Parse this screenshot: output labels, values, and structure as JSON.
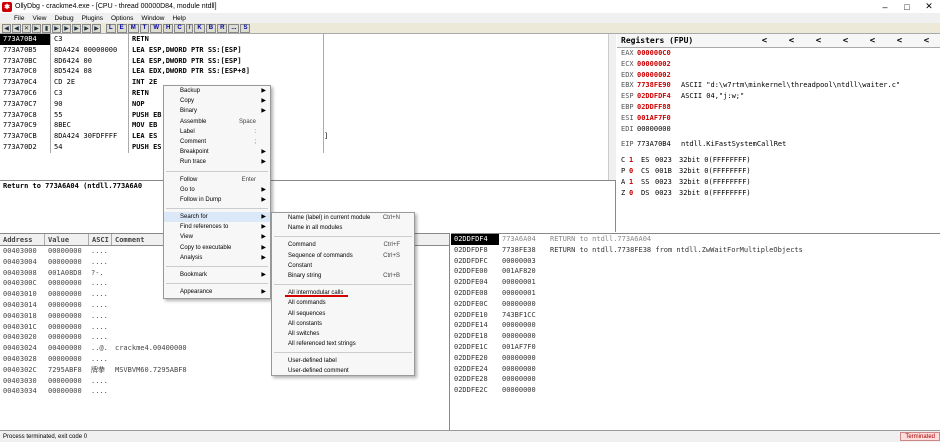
{
  "titlebar": {
    "title": "OllyDbg - crackme4.exe - [CPU - thread 00000D84, module ntdll]",
    "icon": "ollydbg-icon",
    "min": "–",
    "max": "□",
    "close": "✕"
  },
  "menubar": [
    "File",
    "View",
    "Debug",
    "Plugins",
    "Options",
    "Window",
    "Help"
  ],
  "toolbar": {
    "buttons": [
      "◀",
      "◀",
      "✕",
      "▶",
      "▮",
      "▶",
      "▶",
      "▶",
      "▶",
      "▶"
    ],
    "letters": [
      "L",
      "E",
      "M",
      "T",
      "W",
      "H",
      "C",
      "/",
      "K",
      "B",
      "R",
      "...",
      "S"
    ]
  },
  "cpu": {
    "rows": [
      {
        "addr": "773A70B4",
        "hex": "C3",
        "dis": "RETN",
        "cmt": ""
      },
      {
        "addr": "773A70B5",
        "hex": "8DA424 00000000",
        "dis": "LEA ESP,DWORD PTR SS:[ESP]",
        "cmt": ""
      },
      {
        "addr": "773A70BC",
        "hex": "8D6424 00",
        "dis": "LEA ESP,DWORD PTR SS:[ESP]",
        "cmt": ""
      },
      {
        "addr": "773A70C0",
        "hex": "8D5424 08",
        "dis": "LEA EDX,DWORD PTR SS:[ESP+8]",
        "cmt": ""
      },
      {
        "addr": "773A70C4",
        "hex": "CD 2E",
        "dis": "INT 2E",
        "cmt": ""
      },
      {
        "addr": "773A70C6",
        "hex": "C3",
        "dis": "RETN",
        "cmt": ""
      },
      {
        "addr": "773A70C7",
        "hex": "90",
        "dis": "NOP",
        "cmt": ""
      },
      {
        "addr": "773A70C8",
        "hex": "55",
        "dis": "PUSH EB",
        "cmt": ""
      },
      {
        "addr": "773A70C9",
        "hex": "8BEC",
        "dis": "MOV EB",
        "cmt": ""
      },
      {
        "addr": "773A70CB",
        "hex": "8DA424 30FDFFFF",
        "dis": "LEA ES",
        "cmt": "]"
      },
      {
        "addr": "773A70D2",
        "hex": "54",
        "dis": "PUSH ES",
        "cmt": ""
      }
    ]
  },
  "info": {
    "line1": "Return to 773A6A04 (ntdll.773A6A0"
  },
  "registers": {
    "title": "Registers (FPU)",
    "arrows": [
      "<",
      "<",
      "<",
      "<",
      "<",
      "<",
      "<"
    ],
    "rows": [
      {
        "name": "EAX",
        "val": "000000C0",
        "red": true,
        "cmt": ""
      },
      {
        "name": "ECX",
        "val": "00000002",
        "red": true,
        "cmt": ""
      },
      {
        "name": "EDX",
        "val": "00000002",
        "red": true,
        "cmt": ""
      },
      {
        "name": "EBX",
        "val": "7738FE90",
        "red": true,
        "cmt": "ASCII \"d:\\w7rtm\\minkernel\\threadpool\\ntdll\\waiter.c\""
      },
      {
        "name": "ESP",
        "val": "02DDFDF4",
        "red": true,
        "cmt": "ASCII 04,\"j:w;\""
      },
      {
        "name": "EBP",
        "val": "02DDFF88",
        "red": true,
        "cmt": ""
      },
      {
        "name": "ESI",
        "val": "001AF7F0",
        "red": true,
        "cmt": ""
      },
      {
        "name": "EDI",
        "val": "00000000",
        "red": false,
        "cmt": ""
      }
    ],
    "eip": {
      "name": "EIP",
      "val": "773A70B4",
      "cmt": "ntdll.KiFastSystemCallRet"
    },
    "flags": [
      {
        "f": "C",
        "b": "1",
        "seg": "ES",
        "sv": "0023",
        "info": "32bit 0(FFFFFFFF)"
      },
      {
        "f": "P",
        "b": "0",
        "seg": "CS",
        "sv": "001B",
        "info": "32bit 0(FFFFFFFF)"
      },
      {
        "f": "A",
        "b": "1",
        "seg": "SS",
        "sv": "0023",
        "info": "32bit 0(FFFFFFFF)"
      },
      {
        "f": "Z",
        "b": "0",
        "seg": "DS",
        "sv": "0023",
        "info": "32bit 0(FFFFFFFF)"
      }
    ]
  },
  "dump": {
    "headers": [
      "Address",
      "Value",
      "ASCI",
      "Comment"
    ],
    "rows": [
      {
        "a": "00403000",
        "v": "00000000",
        "s": "....",
        "m": ""
      },
      {
        "a": "00403004",
        "v": "00000000",
        "s": "....",
        "m": ""
      },
      {
        "a": "00403008",
        "v": "001A08D8",
        "s": "?-.",
        "m": ""
      },
      {
        "a": "0040300C",
        "v": "00000000",
        "s": "....",
        "m": ""
      },
      {
        "a": "00403010",
        "v": "00000000",
        "s": "....",
        "m": ""
      },
      {
        "a": "00403014",
        "v": "00000000",
        "s": "....",
        "m": ""
      },
      {
        "a": "00403018",
        "v": "00000000",
        "s": "....",
        "m": ""
      },
      {
        "a": "0040301C",
        "v": "00000000",
        "s": "....",
        "m": ""
      },
      {
        "a": "00403020",
        "v": "00000000",
        "s": "....",
        "m": ""
      },
      {
        "a": "00403024",
        "v": "00400000",
        "s": "..@.",
        "m": "crackme4.00400000"
      },
      {
        "a": "00403028",
        "v": "00000000",
        "s": "....",
        "m": ""
      },
      {
        "a": "0040302C",
        "v": "7295ABF8",
        "s": "牌拲",
        "m": "MSVBVM60.7295ABF8"
      },
      {
        "a": "00403030",
        "v": "00000000",
        "s": "....",
        "m": ""
      },
      {
        "a": "00403034",
        "v": "00000000",
        "s": "....",
        "m": ""
      }
    ]
  },
  "stack": {
    "rows": [
      {
        "a": "02DDFDF4",
        "v": "773A6A04",
        "c": "RETURN to ntdll.773A6A04"
      },
      {
        "a": "02DDFDF8",
        "v": "7738FE38",
        "c": "RETURN to ntdll.7738FE38 from ntdll.ZwWaitForMultipleObjects"
      },
      {
        "a": "02DDFDFC",
        "v": "00000003",
        "c": ""
      },
      {
        "a": "02DDFE00",
        "v": "001AF820",
        "c": ""
      },
      {
        "a": "02DDFE04",
        "v": "00000001",
        "c": ""
      },
      {
        "a": "02DDFE08",
        "v": "00000001",
        "c": ""
      },
      {
        "a": "02DDFE0C",
        "v": "00000000",
        "c": ""
      },
      {
        "a": "02DDFE10",
        "v": "743BF1CC",
        "c": ""
      },
      {
        "a": "02DDFE14",
        "v": "00000000",
        "c": ""
      },
      {
        "a": "02DDFE18",
        "v": "00000000",
        "c": ""
      },
      {
        "a": "02DDFE1C",
        "v": "001AF7F0",
        "c": ""
      },
      {
        "a": "02DDFE20",
        "v": "00000000",
        "c": ""
      },
      {
        "a": "02DDFE24",
        "v": "00000000",
        "c": ""
      },
      {
        "a": "02DDFE28",
        "v": "00000000",
        "c": ""
      },
      {
        "a": "02DDFE2C",
        "v": "00000000",
        "c": ""
      }
    ]
  },
  "context_menu": {
    "items": [
      {
        "label": "Backup",
        "shortcut": "",
        "sub": true
      },
      {
        "label": "Copy",
        "shortcut": "",
        "sub": true
      },
      {
        "label": "Binary",
        "shortcut": "",
        "sub": true
      },
      {
        "label": "Assemble",
        "shortcut": "Space",
        "sub": false
      },
      {
        "label": "Label",
        "shortcut": ":",
        "sub": false
      },
      {
        "label": "Comment",
        "shortcut": ";",
        "sub": false
      },
      {
        "label": "Breakpoint",
        "shortcut": "",
        "sub": true
      },
      {
        "label": "Run trace",
        "shortcut": "",
        "sub": true
      },
      {
        "sep": true
      },
      {
        "label": "Follow",
        "shortcut": "Enter",
        "sub": false
      },
      {
        "label": "Go to",
        "shortcut": "",
        "sub": true
      },
      {
        "label": "Follow in Dump",
        "shortcut": "",
        "sub": true
      },
      {
        "sep": true
      },
      {
        "label": "Search for",
        "shortcut": "",
        "sub": true,
        "hl": true
      },
      {
        "label": "Find references to",
        "shortcut": "",
        "sub": true
      },
      {
        "label": "View",
        "shortcut": "",
        "sub": true
      },
      {
        "label": "Copy to executable",
        "shortcut": "",
        "sub": true
      },
      {
        "label": "Analysis",
        "shortcut": "",
        "sub": true
      },
      {
        "sep": true
      },
      {
        "label": "Bookmark",
        "shortcut": "",
        "sub": true
      },
      {
        "sep": true
      },
      {
        "label": "Appearance",
        "shortcut": "",
        "sub": true
      }
    ]
  },
  "submenu": {
    "items": [
      {
        "label": "Name (label) in current module",
        "shortcut": "Ctrl+N"
      },
      {
        "label": "Name in all modules",
        "shortcut": ""
      },
      {
        "sep": true
      },
      {
        "label": "Command",
        "shortcut": "Ctrl+F"
      },
      {
        "label": "Sequence of commands",
        "shortcut": "Ctrl+S"
      },
      {
        "label": "Constant",
        "shortcut": ""
      },
      {
        "label": "Binary string",
        "shortcut": "Ctrl+B"
      },
      {
        "sep": true
      },
      {
        "label": "All intermodular calls",
        "shortcut": ""
      },
      {
        "label": "All commands",
        "shortcut": ""
      },
      {
        "label": "All sequences",
        "shortcut": ""
      },
      {
        "label": "All constants",
        "shortcut": ""
      },
      {
        "label": "All switches",
        "shortcut": ""
      },
      {
        "label": "All referenced text strings",
        "shortcut": ""
      },
      {
        "sep": true
      },
      {
        "label": "User-defined label",
        "shortcut": ""
      },
      {
        "label": "User-defined comment",
        "shortcut": ""
      }
    ]
  },
  "statusbar": {
    "text": "Process terminated, exit code 0",
    "state": "Terminated"
  },
  "colors": {
    "accent": "#c00000",
    "highlight": "#dbe8f7",
    "underline": "#d40000"
  }
}
